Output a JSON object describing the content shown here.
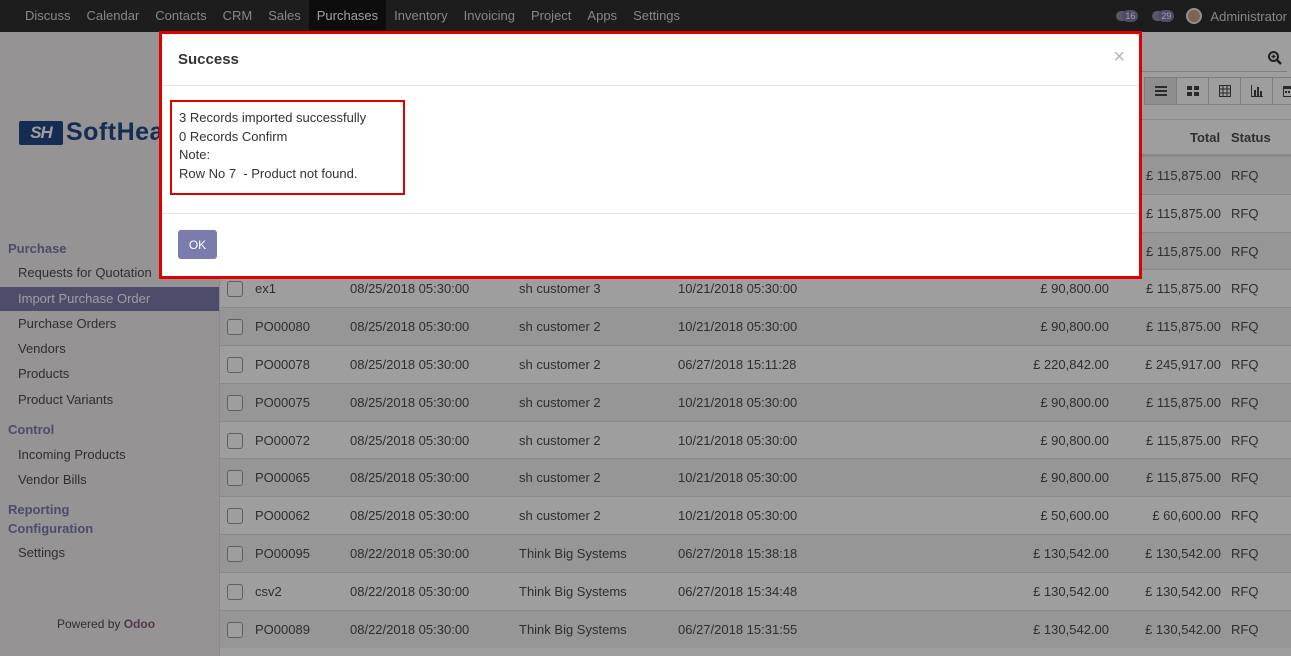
{
  "navbar": {
    "menu": [
      "Discuss",
      "Calendar",
      "Contacts",
      "CRM",
      "Sales",
      "Purchases",
      "Inventory",
      "Invoicing",
      "Project",
      "Apps",
      "Settings"
    ],
    "active": "Purchases",
    "messages_count": "16",
    "activities_count": "29",
    "user": "Administrator"
  },
  "sidebar": {
    "logo_mark": "SH",
    "logo_text": "SoftHea",
    "sections": {
      "purchase": "Purchase",
      "control": "Control",
      "reporting": "Reporting",
      "configuration": "Configuration"
    },
    "purchase_items": [
      "Requests for Quotation",
      "Import Purchase Order",
      "Purchase Orders",
      "Vendors",
      "Products",
      "Product Variants"
    ],
    "control_items": [
      "Incoming Products",
      "Vendor Bills"
    ],
    "config_items": [
      "Settings"
    ],
    "powered_by": "Powered by",
    "powered_brand": "Odoo"
  },
  "table": {
    "headers": {
      "total": "Total",
      "status": "Status"
    },
    "rows": [
      {
        "ref": "",
        "date": "",
        "vendor": "",
        "scheduled": "",
        "untaxed": "",
        "total": "£ 115,875.00",
        "status": "RFQ"
      },
      {
        "ref": "",
        "date": "",
        "vendor": "",
        "scheduled": "",
        "untaxed": "",
        "total": "£ 115,875.00",
        "status": "RFQ"
      },
      {
        "ref": "",
        "date": "",
        "vendor": "",
        "scheduled": "",
        "untaxed": "",
        "total": "£ 115,875.00",
        "status": "RFQ"
      },
      {
        "ref": "ex1",
        "date": "08/25/2018 05:30:00",
        "vendor": "sh customer 3",
        "scheduled": "10/21/2018 05:30:00",
        "untaxed": "£ 90,800.00",
        "total": "£ 115,875.00",
        "status": "RFQ"
      },
      {
        "ref": "PO00080",
        "date": "08/25/2018 05:30:00",
        "vendor": "sh customer 2",
        "scheduled": "10/21/2018 05:30:00",
        "untaxed": "£ 90,800.00",
        "total": "£ 115,875.00",
        "status": "RFQ"
      },
      {
        "ref": "PO00078",
        "date": "08/25/2018 05:30:00",
        "vendor": "sh customer 2",
        "scheduled": "06/27/2018 15:11:28",
        "untaxed": "£ 220,842.00",
        "total": "£ 245,917.00",
        "status": "RFQ"
      },
      {
        "ref": "PO00075",
        "date": "08/25/2018 05:30:00",
        "vendor": "sh customer 2",
        "scheduled": "10/21/2018 05:30:00",
        "untaxed": "£ 90,800.00",
        "total": "£ 115,875.00",
        "status": "RFQ"
      },
      {
        "ref": "PO00072",
        "date": "08/25/2018 05:30:00",
        "vendor": "sh customer 2",
        "scheduled": "10/21/2018 05:30:00",
        "untaxed": "£ 90,800.00",
        "total": "£ 115,875.00",
        "status": "RFQ"
      },
      {
        "ref": "PO00065",
        "date": "08/25/2018 05:30:00",
        "vendor": "sh customer 2",
        "scheduled": "10/21/2018 05:30:00",
        "untaxed": "£ 90,800.00",
        "total": "£ 115,875.00",
        "status": "RFQ"
      },
      {
        "ref": "PO00062",
        "date": "08/25/2018 05:30:00",
        "vendor": "sh customer 2",
        "scheduled": "10/21/2018 05:30:00",
        "untaxed": "£ 50,600.00",
        "total": "£ 60,600.00",
        "status": "RFQ"
      },
      {
        "ref": "PO00095",
        "date": "08/22/2018 05:30:00",
        "vendor": "Think Big Systems",
        "scheduled": "06/27/2018 15:38:18",
        "untaxed": "£ 130,542.00",
        "total": "£ 130,542.00",
        "status": "RFQ"
      },
      {
        "ref": "csv2",
        "date": "08/22/2018 05:30:00",
        "vendor": "Think Big Systems",
        "scheduled": "06/27/2018 15:34:48",
        "untaxed": "£ 130,542.00",
        "total": "£ 130,542.00",
        "status": "RFQ"
      },
      {
        "ref": "PO00089",
        "date": "08/22/2018 05:30:00",
        "vendor": "Think Big Systems",
        "scheduled": "06/27/2018 15:31:55",
        "untaxed": "£ 130,542.00",
        "total": "£ 130,542.00",
        "status": "RFQ"
      }
    ]
  },
  "modal": {
    "title": "Success",
    "close": "×",
    "lines": [
      "3 Records imported successfully",
      "0 Records Confirm",
      "Note:",
      "Row No 7  - Product not found."
    ],
    "ok_label": "OK"
  },
  "colors": {
    "accent": "#7c7bad",
    "highlight_border": "#e00000",
    "navbar": "#2f2f2f"
  }
}
